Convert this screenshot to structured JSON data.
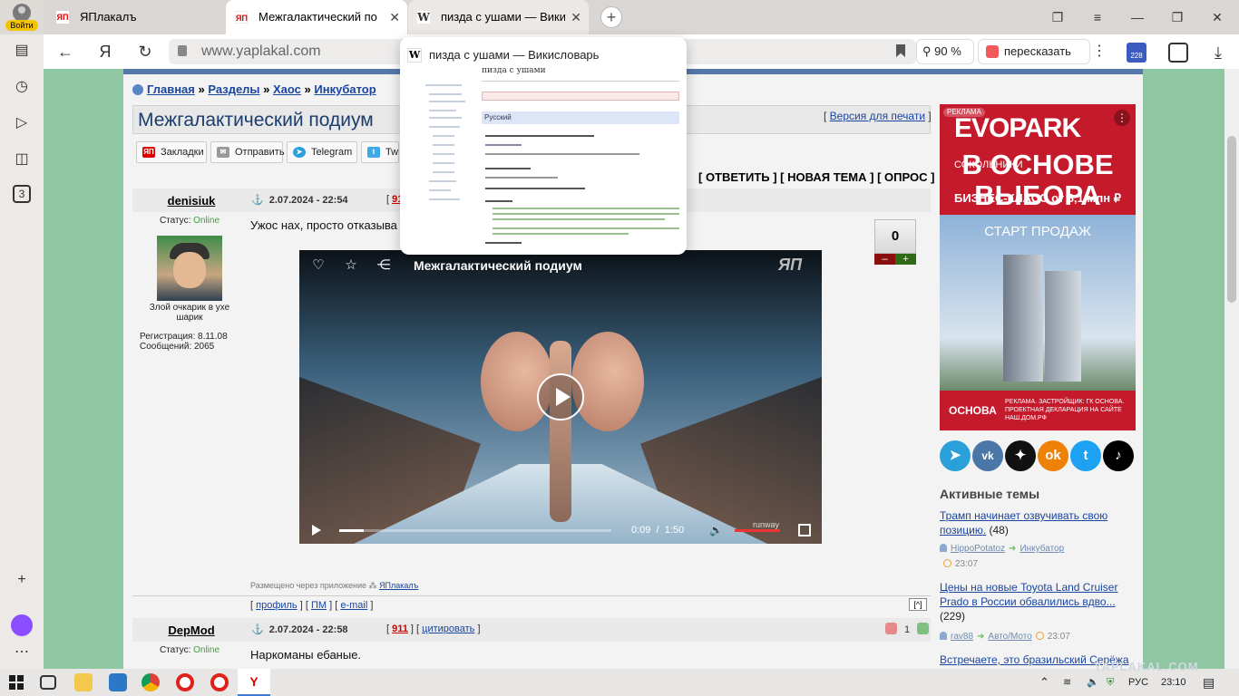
{
  "browser": {
    "profile_label": "Войти",
    "tabs": [
      {
        "label": "ЯПлакалъ",
        "favicon": "ЯП"
      },
      {
        "label": "Межгалактический по",
        "favicon": "ЯП"
      },
      {
        "label": "пизда с ушами — Вики",
        "favicon": "W"
      }
    ],
    "url": "www.yaplakal.com",
    "zoom": "90 %",
    "retell_label": "пересказать",
    "taskbar_badge": "228",
    "sidebar_badge": "3"
  },
  "preview": {
    "title": "пизда с ушами — Викисловарь",
    "page_heading": "пизда с ушами",
    "section": "Русский"
  },
  "page": {
    "crumbs": [
      "Главная",
      "Разделы",
      "Хаос",
      "Инкубатор"
    ],
    "title": "Межгалактический подиум",
    "print_version": "Версия для печати",
    "share": [
      "Закладки",
      "Отправить",
      "Telegram",
      "Tw"
    ],
    "actions": "[ ОТВЕТИТЬ ] [ НОВАЯ ТЕМА ] [ ОПРОС ]",
    "posts": [
      {
        "author": "denisiuk",
        "date": "2.07.2024 - 22:54",
        "num": "911",
        "status_label": "Статус:",
        "status": "Online",
        "desc": "Злой очкарик в ухе шарик",
        "reg": "Регистрация: 8.11.08",
        "msgs": "Сообщений: 2065",
        "text": "Ужос нах, просто отказыва",
        "rating": "0",
        "minus": "–",
        "plus": "+"
      },
      {
        "author": "DepMod",
        "date": "2.07.2024 - 22:58",
        "num": "911",
        "quote": "цитировать",
        "status_label": "Статус:",
        "status": "Online",
        "text": "Наркоманы ебаные.",
        "rating": "1"
      }
    ],
    "video": {
      "title": "Межгалактический подиум",
      "logo": "ЯП",
      "time_current": "0:09",
      "time_sep": "/",
      "time_total": "1:50",
      "progress": 0.09,
      "watermark": "runway"
    },
    "via_app": "Размещено через приложение",
    "via_app_link": "ЯПлакалъ",
    "post_links": [
      "профиль",
      "ПМ",
      "e-mail"
    ],
    "up_label": "[^]"
  },
  "sidebar_right": {
    "ad": {
      "tag": "РЕКЛАМА",
      "brand": "EVOPARK",
      "brand_sub": "СОКОЛЬНИКИ",
      "headline_1": "В ОСНОВЕ",
      "headline_2": "ВЫБОРА",
      "subline": "БИЗНЕС-КЛАСС от 8,1 млн ₽",
      "start": "СТАРТ ПРОДАЖ",
      "logo": "ОСНОВА",
      "legal": "РЕКЛАМА. ЗАСТРОЙЩИК: ГК ОСНОВА. ПРОЕКТНАЯ ДЕКЛАРАЦИЯ НА САЙТЕ НАШ.ДОМ.РФ",
      "color": "#c41a2c"
    },
    "active_heading": "Активные темы",
    "topics": [
      {
        "title": "Трамп начинает озвучивать свою позицию.",
        "count": "(48)",
        "user": "HippoPotatoz",
        "section": "Инкубатор",
        "time": "23:07"
      },
      {
        "title": "Цены на новые Toyota Land Cruiser Prado в России обвалились вдво...",
        "count": "(229)",
        "user": "rav88",
        "section": "Авто/Мото",
        "time": "23:07"
      },
      {
        "title": "Встречаете, это бразильский Серёжа",
        "count": "",
        "user": "",
        "section": "",
        "time": ""
      }
    ]
  },
  "taskbar": {
    "lang": "РУС",
    "time": "23:10",
    "watermark": "YAPLAKAL.COM"
  }
}
